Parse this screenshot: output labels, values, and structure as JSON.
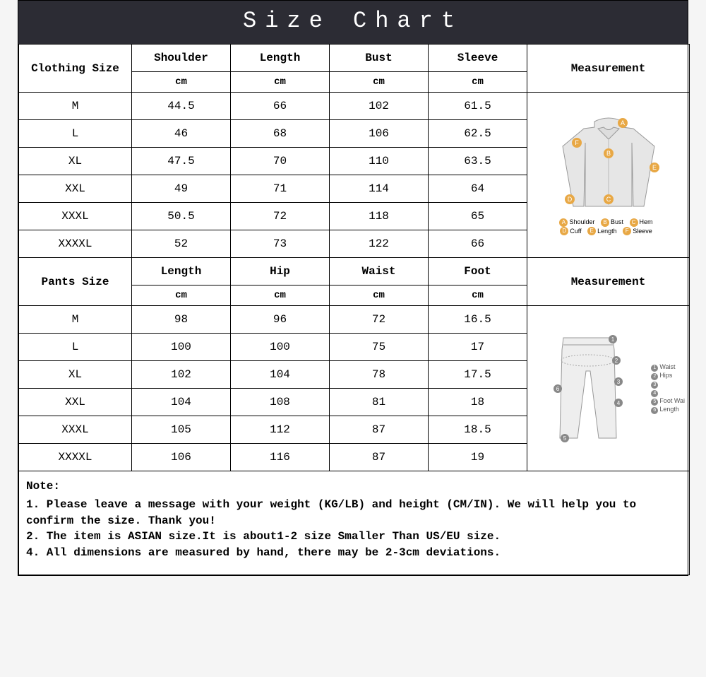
{
  "title": "Size Chart",
  "clothing": {
    "label": "Clothing Size",
    "headers": [
      "Shoulder",
      "Length",
      "Bust",
      "Sleeve"
    ],
    "unit": "cm",
    "measurement_label": "Measurement",
    "rows": [
      {
        "size": "M",
        "vals": [
          "44.5",
          "66",
          "102",
          "61.5"
        ]
      },
      {
        "size": "L",
        "vals": [
          "46",
          "68",
          "106",
          "62.5"
        ]
      },
      {
        "size": "XL",
        "vals": [
          "47.5",
          "70",
          "110",
          "63.5"
        ]
      },
      {
        "size": "XXL",
        "vals": [
          "49",
          "71",
          "114",
          "64"
        ]
      },
      {
        "size": "XXXL",
        "vals": [
          "50.5",
          "72",
          "118",
          "65"
        ]
      },
      {
        "size": "XXXXL",
        "vals": [
          "52",
          "73",
          "122",
          "66"
        ]
      }
    ],
    "legend": [
      {
        "k": "A",
        "v": "Shoulder"
      },
      {
        "k": "B",
        "v": "Bust"
      },
      {
        "k": "C",
        "v": "Hem"
      },
      {
        "k": "D",
        "v": "Cuff"
      },
      {
        "k": "E",
        "v": "Length"
      },
      {
        "k": "F",
        "v": "Sleeve"
      }
    ]
  },
  "pants": {
    "label": "Pants Size",
    "headers": [
      "Length",
      "Hip",
      "Waist",
      "Foot"
    ],
    "unit": "cm",
    "measurement_label": "Measurement",
    "rows": [
      {
        "size": "M",
        "vals": [
          "98",
          "96",
          "72",
          "16.5"
        ]
      },
      {
        "size": "L",
        "vals": [
          "100",
          "100",
          "75",
          "17"
        ]
      },
      {
        "size": "XL",
        "vals": [
          "102",
          "104",
          "78",
          "17.5"
        ]
      },
      {
        "size": "XXL",
        "vals": [
          "104",
          "108",
          "81",
          "18"
        ]
      },
      {
        "size": "XXXL",
        "vals": [
          "105",
          "112",
          "87",
          "18.5"
        ]
      },
      {
        "size": "XXXXL",
        "vals": [
          "106",
          "116",
          "87",
          "19"
        ]
      }
    ],
    "legend": [
      {
        "k": "1",
        "v": "Waist"
      },
      {
        "k": "2",
        "v": "Hips"
      },
      {
        "k": "3",
        "v": ""
      },
      {
        "k": "4",
        "v": ""
      },
      {
        "k": "5",
        "v": "Foot Wai"
      },
      {
        "k": "6",
        "v": "Length"
      }
    ]
  },
  "note": {
    "title": "Note:",
    "lines": [
      "1. Please leave a message with your weight (KG/LB) and height (CM/IN). We will help you to confirm the size. Thank you!",
      "2. The item is ASIAN size.It is about1-2 size Smaller Than US/EU size.",
      "4. All dimensions are measured by hand, there may be 2-3cm deviations."
    ]
  },
  "chart_data": [
    {
      "type": "table",
      "title": "Clothing Size (cm)",
      "columns": [
        "Size",
        "Shoulder",
        "Length",
        "Bust",
        "Sleeve"
      ],
      "rows": [
        [
          "M",
          44.5,
          66,
          102,
          61.5
        ],
        [
          "L",
          46,
          68,
          106,
          62.5
        ],
        [
          "XL",
          47.5,
          70,
          110,
          63.5
        ],
        [
          "XXL",
          49,
          71,
          114,
          64
        ],
        [
          "XXXL",
          50.5,
          72,
          118,
          65
        ],
        [
          "XXXXL",
          52,
          73,
          122,
          66
        ]
      ]
    },
    {
      "type": "table",
      "title": "Pants Size (cm)",
      "columns": [
        "Size",
        "Length",
        "Hip",
        "Waist",
        "Foot"
      ],
      "rows": [
        [
          "M",
          98,
          96,
          72,
          16.5
        ],
        [
          "L",
          100,
          100,
          75,
          17
        ],
        [
          "XL",
          102,
          104,
          78,
          17.5
        ],
        [
          "XXL",
          104,
          108,
          81,
          18
        ],
        [
          "XXXL",
          105,
          112,
          87,
          18.5
        ],
        [
          "XXXXL",
          106,
          116,
          87,
          19
        ]
      ]
    }
  ]
}
